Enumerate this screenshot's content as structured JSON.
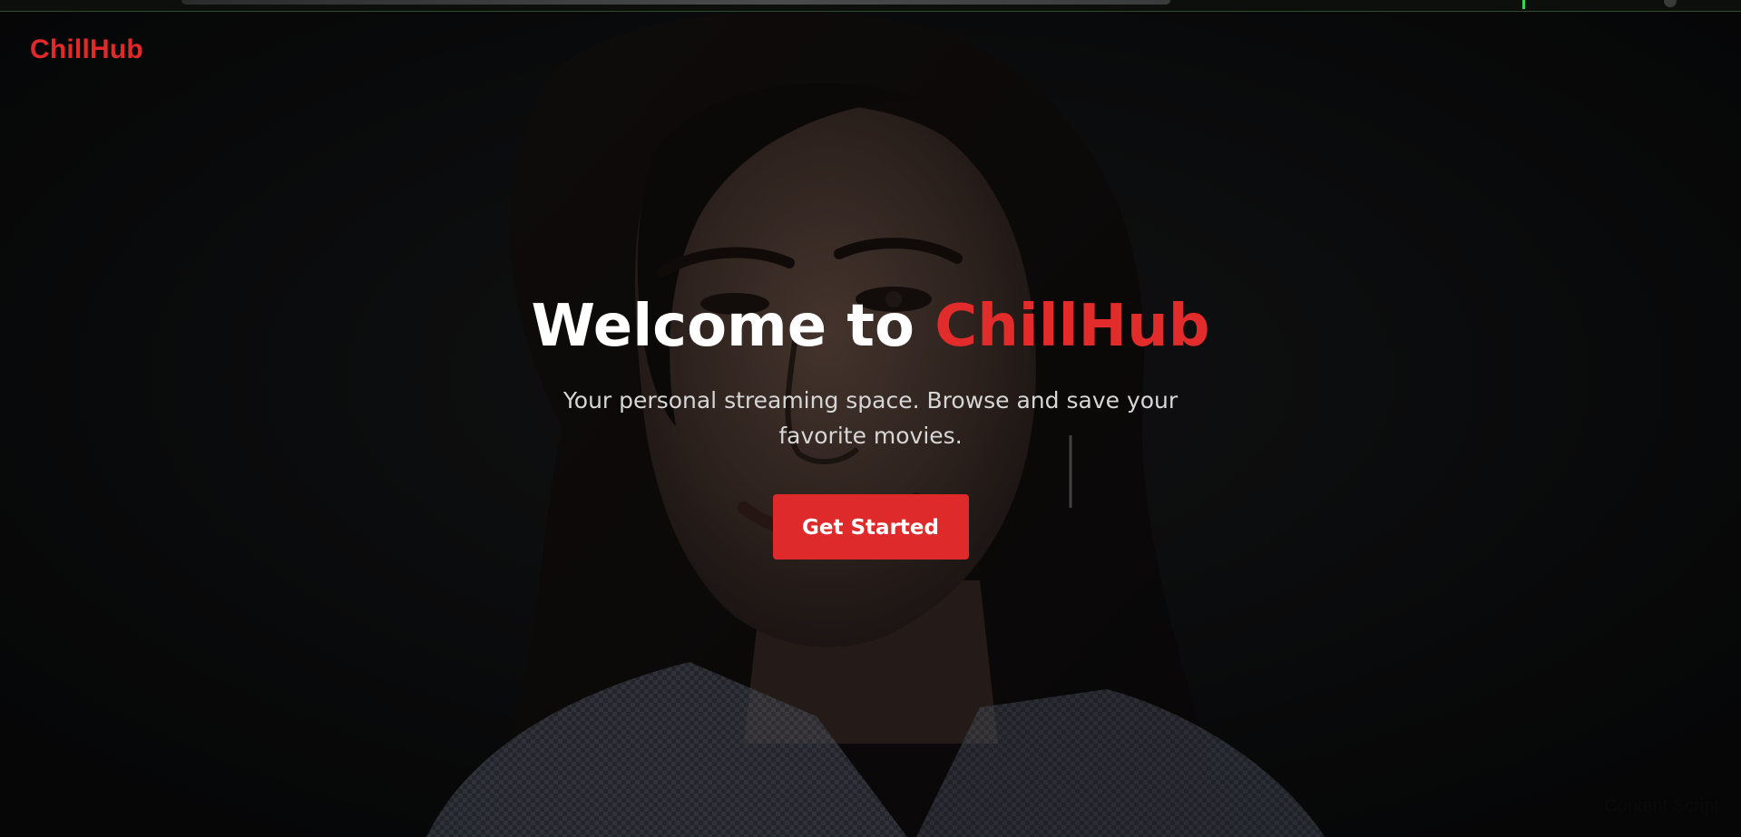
{
  "brand": {
    "logo": "ChillHub",
    "accent_color": "#E02A2A"
  },
  "hero": {
    "title_prefix": "Welcome to ",
    "title_brand": "ChillHub",
    "subtitle": "Your personal streaming space. Browse and save your favorite movies.",
    "cta_label": "Get Started",
    "background": "portrait-photo"
  },
  "footer": {
    "overlay_text": "Content Script"
  }
}
